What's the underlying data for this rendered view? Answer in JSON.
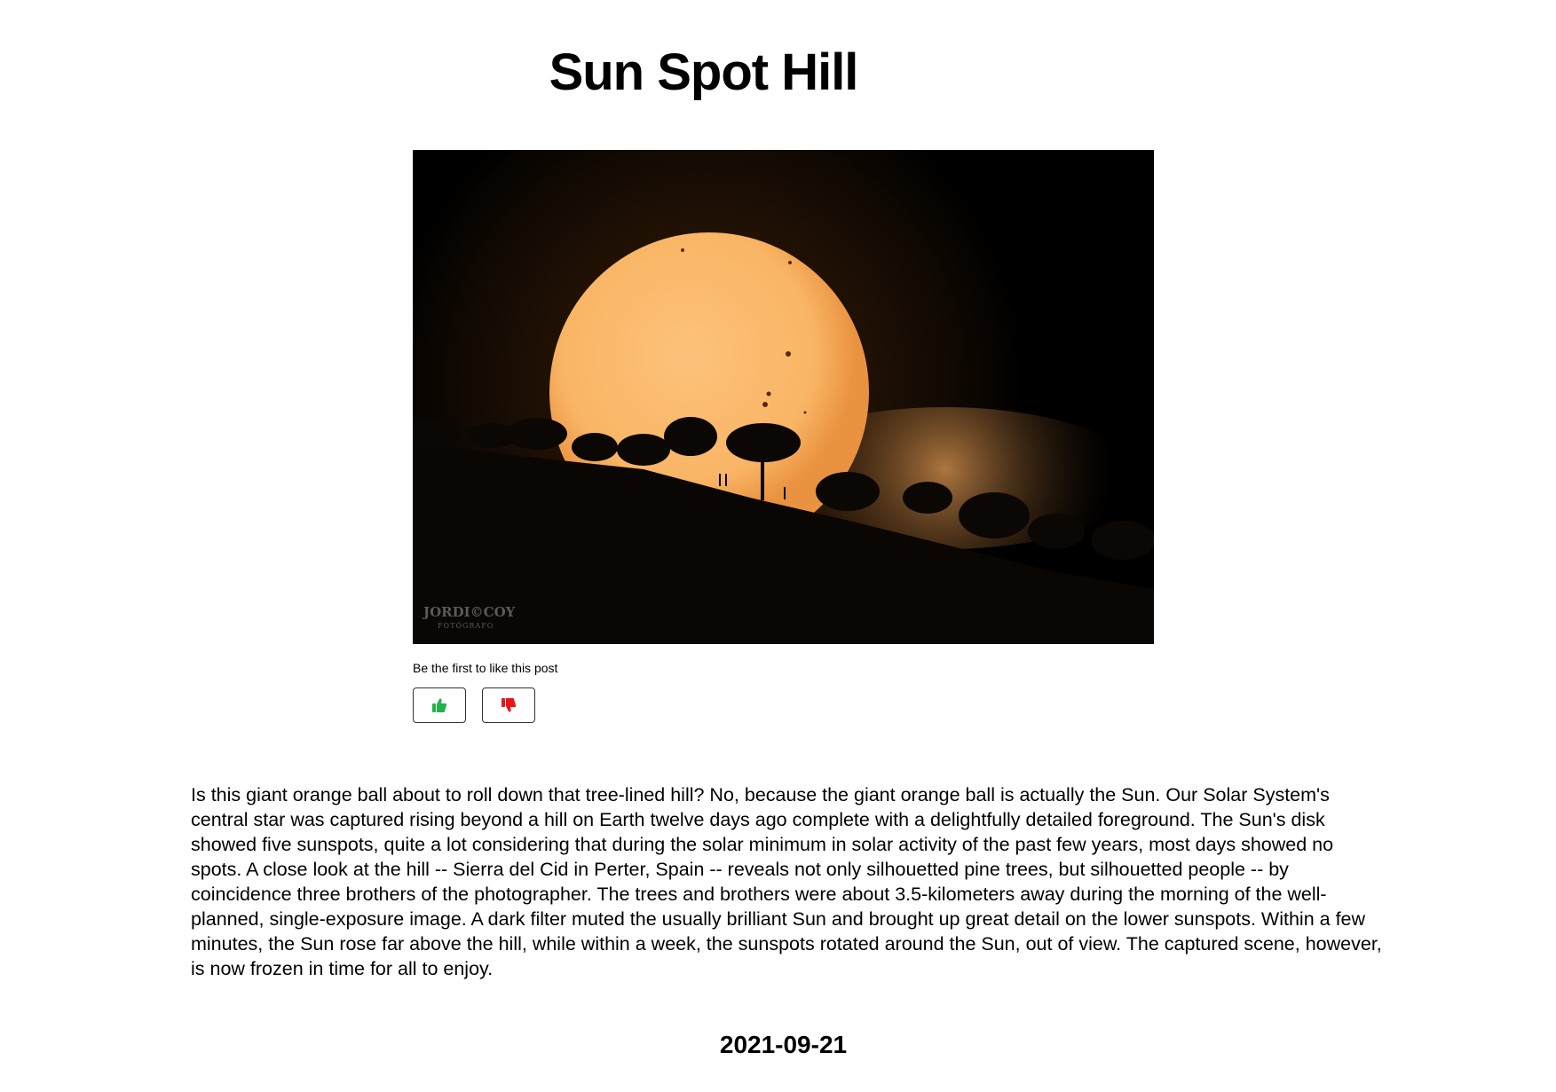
{
  "post": {
    "title": "Sun Spot Hill",
    "image": {
      "alt": "Sun rising behind a tree-lined hill",
      "watermark_line1": "JORDI©COY",
      "watermark_line2": "FOTÓGRAFO"
    },
    "likes_text": "Be the first to like this post",
    "like_icon": "thumbs-up-icon",
    "dislike_icon": "thumbs-down-icon",
    "description": "Is this giant orange ball about to roll down that tree-lined hill? No, because the giant orange ball is actually the Sun. Our Solar System's central star was captured rising beyond a hill on Earth twelve days ago complete with a delightfully detailed foreground. The Sun's disk showed five sunspots, quite a lot considering that during the solar minimum in solar activity of the past few years, most days showed no spots. A close look at the hill -- Sierra del Cid in Perter, Spain -- reveals not only silhouetted pine trees, but silhouetted people -- by coincidence three brothers of the photographer. The trees and brothers were about 3.5-kilometers away during the morning of the well-planned, single-exposure image. A dark filter muted the usually brilliant Sun and brought up great detail on the lower sunspots. Within a few minutes, the Sun rose far above the hill, while within a week, the sunspots rotated around the Sun, out of view. The captured scene, however, is now frozen in time for all to enjoy.",
    "date": "2021-09-21"
  },
  "colors": {
    "like": "#22b14c",
    "dislike": "#e8141c",
    "sun": "#f7b15c"
  }
}
